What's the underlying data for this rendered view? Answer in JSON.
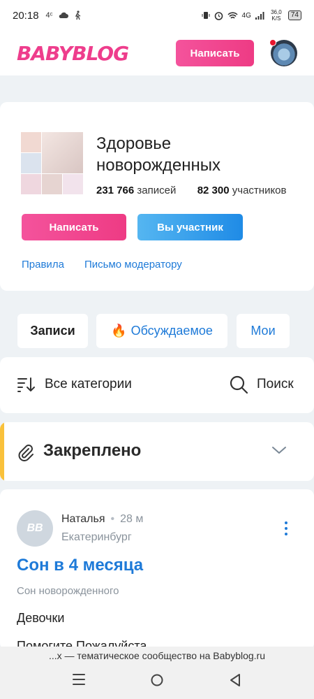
{
  "status_bar": {
    "time": "20:18",
    "left_icons": [
      "4ᶜ",
      "cloud-icon",
      "walking-icon"
    ],
    "network": "4G",
    "speed": "36,0 K/S",
    "battery": "74"
  },
  "header": {
    "logo": "BABYBLOG",
    "write_button": "Написать"
  },
  "community": {
    "title": "Здоровье новорожденных",
    "posts_count": "231 766",
    "posts_label": "записей",
    "members_count": "82 300",
    "members_label": "участников",
    "write_button": "Написать",
    "member_button": "Вы участник",
    "rules_link": "Правила",
    "moderator_link": "Письмо модератору"
  },
  "tabs": {
    "posts": "Записи",
    "discussed": "Обсуждаемое",
    "mine": "Мои"
  },
  "filter": {
    "categories": "Все категории",
    "search": "Поиск"
  },
  "pinned": {
    "label": "Закреплено"
  },
  "post": {
    "avatar_initials": "BB",
    "author": "Наталья",
    "time": "28 м",
    "city": "Екатеринбург",
    "title": "Сон в 4 месяца",
    "category": "Сон новорожденного",
    "text_line1": "Девочки",
    "text_line2": "Помогите Пожалуйста"
  },
  "bottom": {
    "banner": "...х — тематическое сообщество на Babyblog.ru"
  },
  "colors": {
    "brand_pink": "#ee3d8c",
    "link_blue": "#1e7ad8",
    "pinned_accent": "#f9c13b"
  }
}
